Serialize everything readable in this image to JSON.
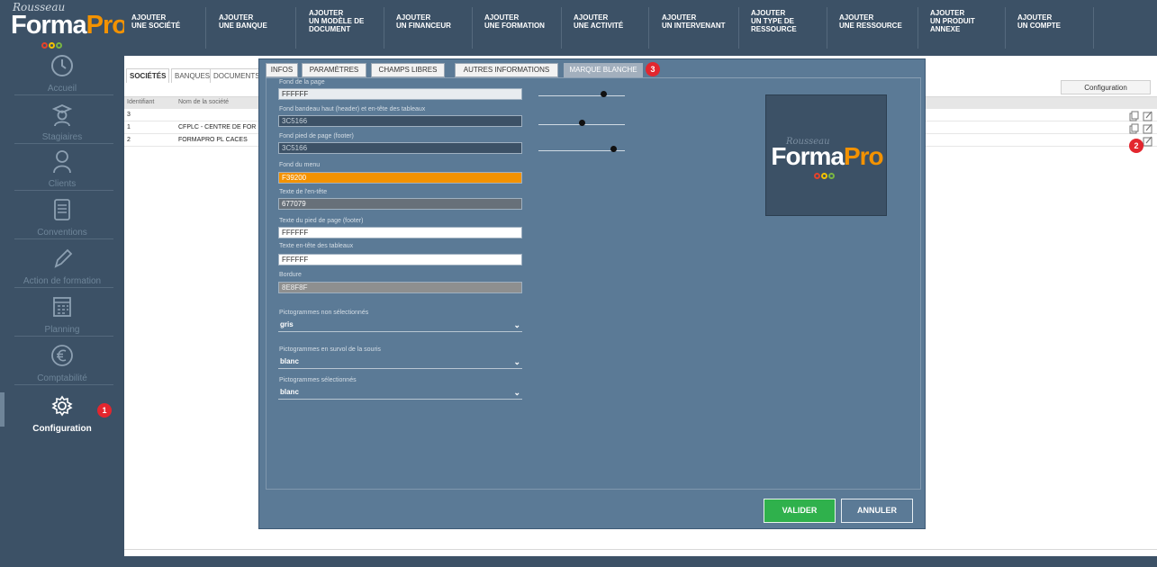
{
  "app": {
    "brand_small": "Rousseau",
    "brand_forma": "Forma",
    "brand_pro": "Pro"
  },
  "colors": {
    "sidebar_bg": "#3c5166",
    "accent_orange": "#f39200",
    "valider_green": "#2fb14c",
    "badge_red": "#e3262e",
    "modal_bg": "#5b7a96"
  },
  "sidebar": {
    "items": [
      {
        "label": "Accueil",
        "icon": "clock-icon"
      },
      {
        "label": "Stagiaires",
        "icon": "graduate-icon"
      },
      {
        "label": "Clients",
        "icon": "user-icon"
      },
      {
        "label": "Conventions",
        "icon": "document-icon"
      },
      {
        "label": "Action de formation",
        "icon": "pencil-icon"
      },
      {
        "label": "Planning",
        "icon": "calendar-icon"
      },
      {
        "label": "Comptabilité",
        "icon": "euro-icon"
      },
      {
        "label": "Configuration",
        "icon": "gear-icon"
      }
    ],
    "badge_1": "1"
  },
  "topbar": {
    "items": [
      {
        "line1": "AJOUTER",
        "line2": "UNE SOCIÉTÉ",
        "line3": ""
      },
      {
        "line1": "AJOUTER",
        "line2": "UNE BANQUE",
        "line3": ""
      },
      {
        "line1": "AJOUTER",
        "line2": "UN MODÈLE DE",
        "line3": "DOCUMENT"
      },
      {
        "line1": "AJOUTER",
        "line2": "UN FINANCEUR",
        "line3": ""
      },
      {
        "line1": "AJOUTER",
        "line2": "UNE FORMATION",
        "line3": ""
      },
      {
        "line1": "AJOUTER",
        "line2": "UNE ACTIVITÉ",
        "line3": ""
      },
      {
        "line1": "AJOUTER",
        "line2": "UN INTERVENANT",
        "line3": ""
      },
      {
        "line1": "AJOUTER",
        "line2": "UN TYPE DE",
        "line3": "RESSOURCE"
      },
      {
        "line1": "AJOUTER",
        "line2": "UNE RESSOURCE",
        "line3": ""
      },
      {
        "line1": "AJOUTER",
        "line2": "UN PRODUIT",
        "line3": "ANNEXE"
      },
      {
        "line1": "AJOUTER",
        "line2": "UN COMPTE",
        "line3": ""
      }
    ]
  },
  "content": {
    "tabs": [
      "SOCIÉTÉS",
      "BANQUES",
      "DOCUMENTS"
    ],
    "config_button": "Configuration",
    "columns": [
      "Identifiant",
      "Nom de la société"
    ],
    "rows": [
      {
        "id": "3",
        "name": ""
      },
      {
        "id": "1",
        "name": "CFPLC - CENTRE DE FOR"
      },
      {
        "id": "2",
        "name": "FORMAPRO PL CACES"
      }
    ],
    "badge_2": "2"
  },
  "modal": {
    "tabs": [
      "INFOS",
      "PARAMÈTRES",
      "CHAMPS LIBRES",
      "AUTRES INFORMATIONS",
      "MARQUE BLANCHE"
    ],
    "badge_3": "3",
    "fields": [
      {
        "label": "Fond de la page",
        "value": "FFFFFF",
        "bg": "#e8ecef",
        "fg": "#333333"
      },
      {
        "label": "Fond bandeau haut (header) et en-tête des tableaux",
        "value": "3C5166",
        "bg": "#3c5166",
        "fg": "#c9d3dc"
      },
      {
        "label": "Fond pied de page (footer)",
        "value": "3C5166",
        "bg": "#3c5166",
        "fg": "#c9d3dc"
      },
      {
        "label": "Fond du menu",
        "value": "F39200",
        "bg": "#f39200",
        "fg": "#ffffff"
      },
      {
        "label": "Texte de l'en-tête",
        "value": "677079",
        "bg": "#677079",
        "fg": "#ffffff"
      },
      {
        "label": "Texte du pied de page (footer)",
        "value": "FFFFFF",
        "bg": "#ffffff",
        "fg": "#333333"
      },
      {
        "label": "Texte en-tête des tableaux",
        "value": "FFFFFF",
        "bg": "#ffffff",
        "fg": "#333333"
      },
      {
        "label": "Bordure",
        "value": "8E8F8F",
        "bg": "#8e8f8f",
        "fg": "#eeeeee"
      }
    ],
    "sliders": [
      0.78,
      0.5,
      0.9
    ],
    "selects": [
      {
        "label": "Pictogrammes non sélectionnés",
        "value": "gris"
      },
      {
        "label": "Pictogrammes en survol de la souris",
        "value": "blanc"
      },
      {
        "label": "Pictogrammes sélectionnés",
        "value": "blanc"
      }
    ],
    "preview": {
      "small": "Rousseau",
      "forma": "Forma",
      "pro": "Pro"
    },
    "valider": "VALIDER",
    "annuler": "ANNULER"
  }
}
